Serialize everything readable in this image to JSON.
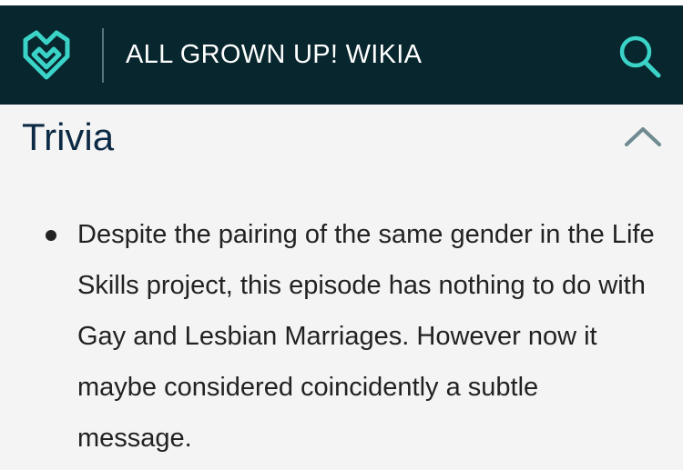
{
  "header": {
    "site_title": "ALL GROWN UP! WIKIA",
    "logo_icon": "fandom-heart-logo-icon",
    "search_icon": "search-icon",
    "accent_color": "#3bd3c8",
    "background_color": "#07262d"
  },
  "section": {
    "title": "Trivia",
    "collapse_icon": "chevron-up-icon",
    "items": [
      {
        "text": "Despite the pairing of the same gender in the Life Skills project, this episode has nothing to do with Gay and Lesbian Marriages. However now it maybe considered coincidently a subtle message."
      }
    ]
  }
}
